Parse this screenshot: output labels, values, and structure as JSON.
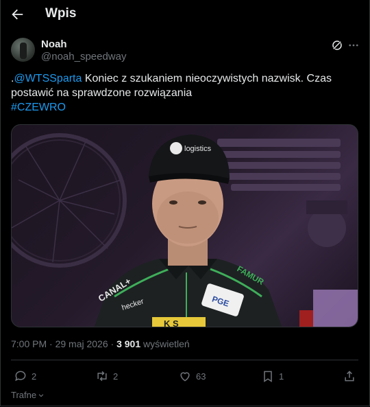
{
  "header": {
    "title": "Wpis"
  },
  "author": {
    "name": "Noah",
    "handle": "@noah_speedway"
  },
  "tweet": {
    "prefix": ".",
    "mention": "@WTSSparta",
    "text": " Koniec z szukaniem nieoczywistych nazwisk. Czas postawić na sprawdzone rozwiązania",
    "hashtag": "#CZEWRO"
  },
  "media": {
    "cap_text": "logistics",
    "badges": [
      "CANAL+",
      "FAMUR",
      "PGE",
      "hecker",
      "K S"
    ]
  },
  "meta": {
    "timestamp": "7:00 PM · 29 maj 2026",
    "separator": " · ",
    "views_count": "3 901",
    "views_label": " wyświetleń"
  },
  "actions": {
    "replies": "2",
    "reposts": "2",
    "likes": "63",
    "bookmarks": "1"
  },
  "sort": {
    "label": "Trafne"
  },
  "colors": {
    "accent": "#1d9bf0",
    "muted": "#71767b",
    "text": "#e7e9ea",
    "background": "#000000"
  }
}
